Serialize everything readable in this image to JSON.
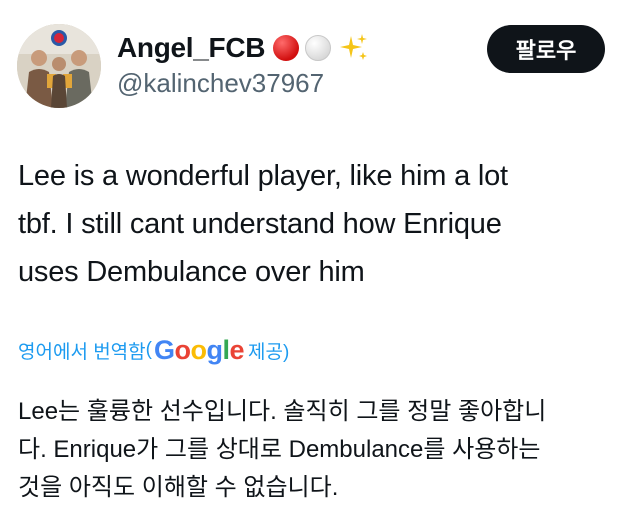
{
  "user": {
    "display_name": "Angel_FCB",
    "handle": "@kalinchev37967",
    "emojis": [
      "red-circle",
      "white-circle",
      "sparkles"
    ]
  },
  "follow_button": {
    "label": "팔로우"
  },
  "tweet": {
    "lines": [
      "Lee is a wonderful player, like him a lot",
      "tbf. I still cant understand how Enrique",
      "uses Dembulance over him"
    ]
  },
  "translation": {
    "prefix": "영어에서 번역함",
    "open_paren": "(",
    "provider_letters": [
      "G",
      "o",
      "o",
      "g",
      "l",
      "e"
    ],
    "suffix": " 제공)",
    "lines": [
      "Lee는 훌륭한 선수입니다. 솔직히 그를 정말 좋아합니",
      "다. Enrique가 그를 상대로 Dembulance를 사용하는",
      "것을 아직도 이해할 수 없습니다."
    ]
  },
  "colors": {
    "link": "#1d9bf0",
    "handle": "#536471",
    "text": "#0f1419",
    "button_bg": "#0f1419"
  }
}
